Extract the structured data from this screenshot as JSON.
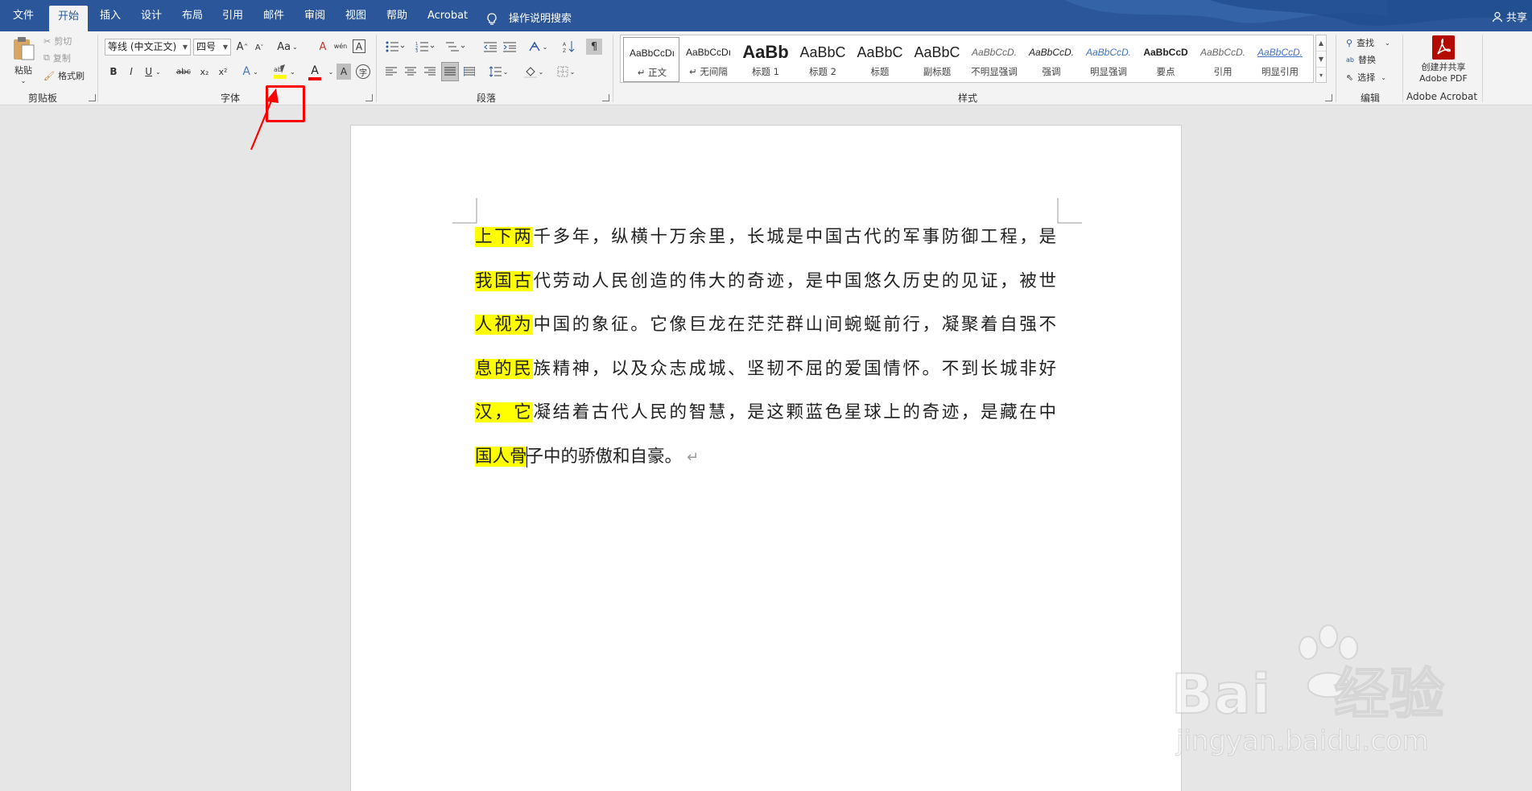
{
  "tabs": [
    {
      "label": "文件"
    },
    {
      "label": "开始"
    },
    {
      "label": "插入"
    },
    {
      "label": "设计"
    },
    {
      "label": "布局"
    },
    {
      "label": "引用"
    },
    {
      "label": "邮件"
    },
    {
      "label": "审阅"
    },
    {
      "label": "视图"
    },
    {
      "label": "帮助"
    },
    {
      "label": "Acrobat"
    }
  ],
  "tell_me": "操作说明搜索",
  "share": "共享",
  "clipboard": {
    "paste": "粘贴",
    "cut": "剪切",
    "copy": "复制",
    "format_painter": "格式刷",
    "label": "剪贴板"
  },
  "font": {
    "name": "等线 (中文正文)",
    "size": "四号",
    "label": "字体",
    "case": "Aa",
    "bold": "B",
    "italic": "I",
    "underline": "U",
    "strike": "abc",
    "sub": "x₂",
    "sup": "x²",
    "grow": "A",
    "shrink": "A",
    "color_letter": "A",
    "shade_letter": "A",
    "enclose": "字",
    "clear": "A",
    "wen": "wén",
    "frame": "A"
  },
  "paragraph": {
    "label": "段落"
  },
  "styles": {
    "label": "样式",
    "items": [
      {
        "preview": "AaBbCcDı",
        "name": "↵ 正文"
      },
      {
        "preview": "AaBbCcDı",
        "name": "↵ 无间隔"
      },
      {
        "preview": "AaBb",
        "name": "标题 1"
      },
      {
        "preview": "AaBbC",
        "name": "标题 2"
      },
      {
        "preview": "AaBbC",
        "name": "标题"
      },
      {
        "preview": "AaBbC",
        "name": "副标题"
      },
      {
        "preview": "AaBbCcD.",
        "name": "不明显强调"
      },
      {
        "preview": "AaBbCcD.",
        "name": "强调"
      },
      {
        "preview": "AaBbCcD.",
        "name": "明显强调"
      },
      {
        "preview": "AaBbCcD",
        "name": "要点"
      },
      {
        "preview": "AaBbCcD.",
        "name": "引用"
      },
      {
        "preview": "AaBbCcD.",
        "name": "明显引用"
      }
    ]
  },
  "editing": {
    "find": "查找",
    "replace": "替换",
    "select": "选择",
    "label": "编辑"
  },
  "acrobat": {
    "line1": "创建并共享",
    "line2": "Adobe PDF",
    "label": "Adobe Acrobat"
  },
  "document": {
    "lines": [
      {
        "hl": "上下两",
        "rest": "千多年，纵横十万余里，长城是中国古代的军事防御工程，是"
      },
      {
        "hl": "我国古",
        "rest": "代劳动人民创造的伟大的奇迹，是中国悠久历史的见证，被世"
      },
      {
        "hl": "人视为",
        "rest": "中国的象征。它像巨龙在茫茫群山间蜿蜒前行，凝聚着自强不"
      },
      {
        "hl": "息的民",
        "rest": "族精神，以及众志成城、坚韧不屈的爱国情怀。不到长城非好"
      },
      {
        "hl": "汉，它",
        "rest": "凝结着古代人民的智慧，是这颗蓝色星球上的奇迹，是藏在中"
      },
      {
        "hl": "国人骨",
        "rest": "子中的骄傲和自豪。"
      }
    ],
    "para_mark": "↵"
  },
  "watermark": {
    "brand": "Bai",
    "cn": "经验",
    "url": "jingyan.baidu.com"
  },
  "colors": {
    "accent": "#2b579a",
    "highlight": "#ffff00",
    "annotation": "#ff0000"
  }
}
